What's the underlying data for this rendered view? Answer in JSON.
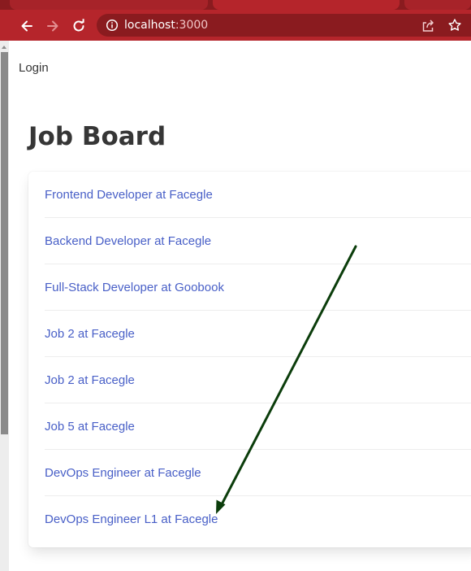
{
  "browser": {
    "url_host": "localhost",
    "url_port": ":3000",
    "icons": {
      "back": "arrow-left-icon",
      "forward": "arrow-right-icon",
      "reload": "reload-icon",
      "info": "info-icon",
      "share": "share-icon",
      "bookmark": "star-icon"
    },
    "colors": {
      "frame": "#8a1b1f",
      "toolbar": "#b5252b"
    }
  },
  "nav": {
    "login_label": "Login"
  },
  "main": {
    "title": "Job Board",
    "jobs": [
      {
        "title": "Frontend Developer at Facegle"
      },
      {
        "title": "Backend Developer at Facegle"
      },
      {
        "title": "Full-Stack Developer at Goobook"
      },
      {
        "title": "Job 2 at Facegle"
      },
      {
        "title": "Job 2 at Facegle"
      },
      {
        "title": "Job 5 at Facegle"
      },
      {
        "title": "DevOps Engineer at Facegle"
      },
      {
        "title": "DevOps Engineer L1 at Facegle"
      }
    ],
    "link_color": "#485fc7"
  },
  "annotation": {
    "arrow_color": "#0b3d0b",
    "points_to": "DevOps Engineer L1 at Facegle"
  }
}
